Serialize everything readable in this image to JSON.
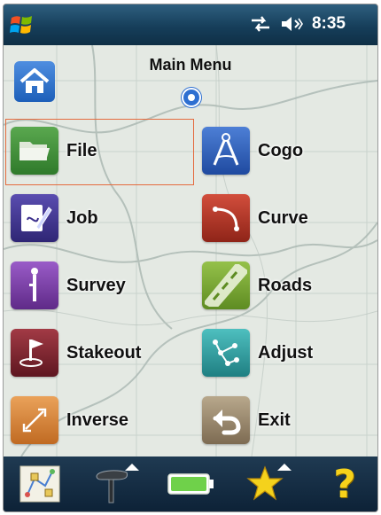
{
  "status_bar": {
    "time": "8:35",
    "icons": [
      "windows-start-icon",
      "connectivity-icon",
      "volume-muted-icon"
    ]
  },
  "main": {
    "title": "Main Menu",
    "home_icon": "home-icon",
    "gps_icon": "gps-position-icon",
    "selected_item": "File",
    "menu": [
      {
        "label": "File",
        "icon": "folder-icon",
        "color": "#3f8a3a"
      },
      {
        "label": "Cogo",
        "icon": "compass-icon",
        "color": "#2d5bb0"
      },
      {
        "label": "Job",
        "icon": "job-edit-icon",
        "color": "#3b2f8c"
      },
      {
        "label": "Curve",
        "icon": "curve-icon",
        "color": "#b43a2c"
      },
      {
        "label": "Survey",
        "icon": "survey-rod-icon",
        "color": "#7a3ea8"
      },
      {
        "label": "Roads",
        "icon": "road-icon",
        "color": "#7aa331"
      },
      {
        "label": "Stakeout",
        "icon": "stakeout-flag-icon",
        "color": "#7d2330"
      },
      {
        "label": "Adjust",
        "icon": "adjust-network-icon",
        "color": "#2e9a9c"
      },
      {
        "label": "Inverse",
        "icon": "inverse-arrows-icon",
        "color": "#d98a3a"
      },
      {
        "label": "Exit",
        "icon": "exit-back-icon",
        "color": "#9c8a72"
      }
    ]
  },
  "bottom_bar": {
    "icons": [
      "map-icon",
      "gps-receiver-icon",
      "battery-icon",
      "favorites-star-icon",
      "help-icon"
    ],
    "help_symbol": "?"
  }
}
